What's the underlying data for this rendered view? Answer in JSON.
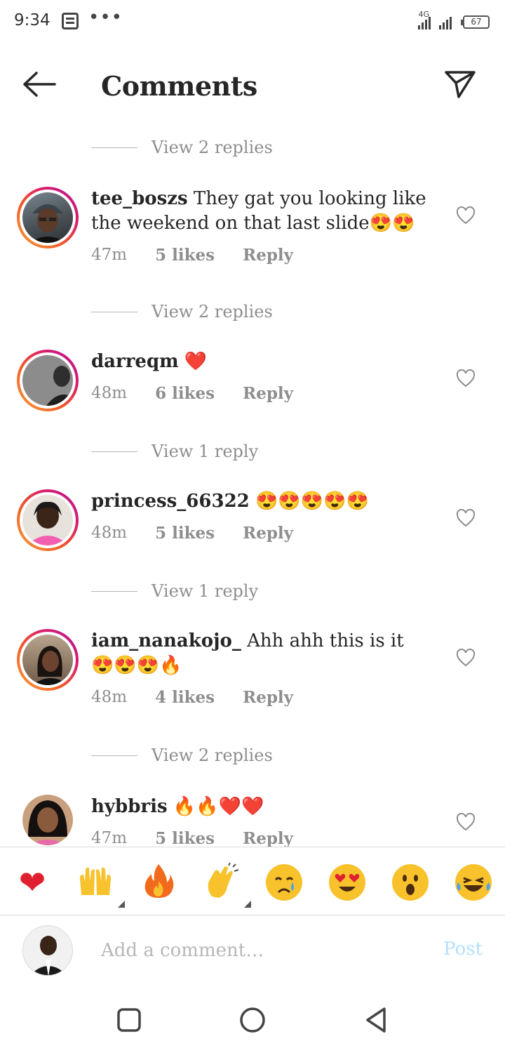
{
  "status_bar": {
    "time": "9:34",
    "network": "4G",
    "battery": "67"
  },
  "header": {
    "title": "Comments"
  },
  "comments": [
    {
      "username": "tee_boszs",
      "text": "They gat you looking like the weekend on that last slide😍😍",
      "time": "47m",
      "likes": "5 likes",
      "reply": "Reply",
      "replies_label": "View 2 replies"
    },
    {
      "username": "darreqm",
      "text": "❤️",
      "time": "48m",
      "likes": "6 likes",
      "reply": "Reply",
      "replies_label": "View 1 reply"
    },
    {
      "username": "princess_66322",
      "text": "😍😍😍😍😍",
      "time": "48m",
      "likes": "5 likes",
      "reply": "Reply",
      "replies_label": "View 1 reply"
    },
    {
      "username": "iam_nanakojo_",
      "text": "Ahh ahh this is it 😍😍😍🔥",
      "time": "48m",
      "likes": "4 likes",
      "reply": "Reply",
      "replies_label": "View 2 replies"
    },
    {
      "username": "hybbris",
      "text": "🔥🔥❤️❤️",
      "time": "47m",
      "likes": "5 likes",
      "reply": "Reply"
    }
  ],
  "top_replies_label": "View 2 replies",
  "quick_reactions": [
    "heart",
    "raised-hands",
    "fire",
    "clapping-hands",
    "crying-face",
    "heart-eyes-face",
    "surprised-face",
    "laughing-tears-face"
  ],
  "input": {
    "placeholder": "Add a comment…",
    "post_label": "Post"
  },
  "colors": {
    "primary_text": "#262626",
    "secondary_text": "#8e8e8e",
    "post_disabled": "#b2dffc",
    "story_ring_start": "#f9a13a",
    "story_ring_end": "#b3169b"
  }
}
